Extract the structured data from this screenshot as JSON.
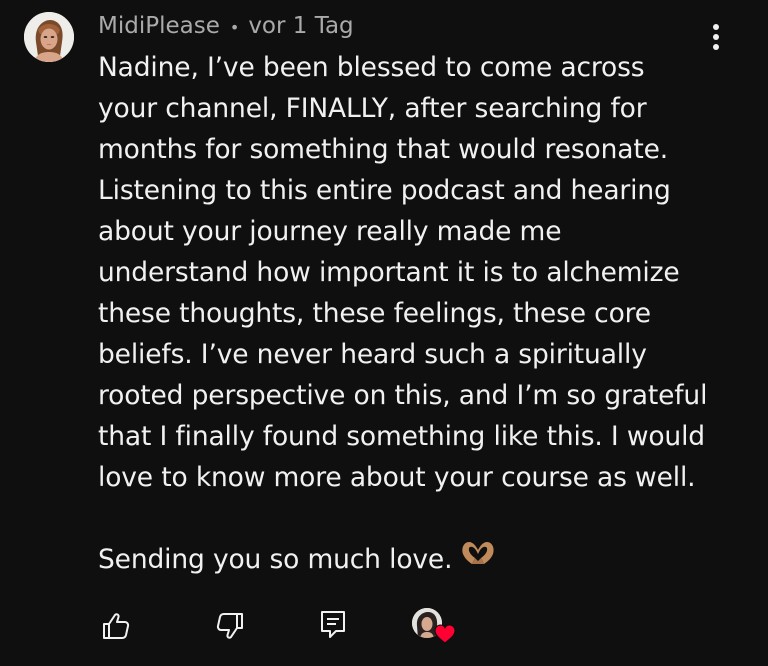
{
  "comment": {
    "author": "MidiPlease",
    "separator": "•",
    "time": "vor 1 Tag",
    "lines": [
      "Nadine, I’ve been blessed to come across",
      "your channel, FINALLY, after searching for",
      "months for something that would resonate.",
      "Listening to this entire podcast and hearing",
      "about your journey really made me",
      "understand how important it is to alchemize",
      "these thoughts, these feelings, these core",
      "beliefs. I’ve never heard such a spiritually",
      "rooted perspective on this, and I’m so grateful",
      "that I finally found something like this. I would",
      "love to know more about your course as well."
    ],
    "closing": "Sending you so much love."
  },
  "icons": {
    "avatar": "user-avatar",
    "more": "vertical-dots-icon",
    "heart_hands": "heart-hands-emoji",
    "like": "thumbs-up-icon",
    "dislike": "thumbs-down-icon",
    "reply": "reply-comment-icon",
    "creator_heart": "creator-heart-icon"
  },
  "colors": {
    "background": "#0f0f0f",
    "text": "#f1f1f1",
    "meta_text": "#aaaaaa",
    "heart_red": "#ff0033"
  }
}
